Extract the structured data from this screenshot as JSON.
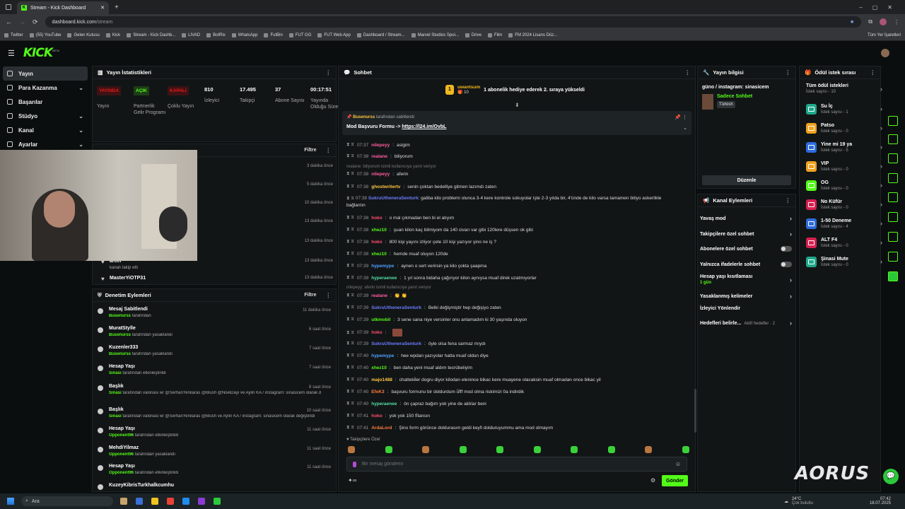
{
  "browser": {
    "tab_title": "Stream - Kick Dashboard",
    "url_host": "dashboard.kick.com",
    "url_path": "/stream",
    "bookmarks": [
      "Twitter",
      "(55) YouTube",
      "Gelen Kutusu",
      "Kick",
      "Stream - Kick Dashb...",
      "LIVAD",
      "BotRix",
      "WhatsApp",
      "FutBin",
      "FUT GG",
      "FUT Web App",
      "Dashboard / Stream...",
      "Marvel Studios Spoi...",
      "Drive",
      "Film",
      "FM 2024 Lisans Düz..."
    ],
    "all_bookmarks": "Tüm Yer İşaretleri"
  },
  "app": {
    "logo": "KICK",
    "logo_sup": "BETA"
  },
  "sidebar": {
    "items": [
      {
        "label": "Yayın"
      },
      {
        "label": "Para Kazanma"
      },
      {
        "label": "Başarılar"
      },
      {
        "label": "Stüdyo"
      },
      {
        "label": "Kanal"
      },
      {
        "label": "Ayarlar"
      }
    ]
  },
  "stats": {
    "title": "Yayın İstatistikleri",
    "cols": [
      {
        "badge": "YAYINDA",
        "badge_color": "#e91916",
        "label": "Yayın"
      },
      {
        "badge": "AÇIK",
        "badge_color": "#53fc18",
        "label": "Partnerlik Gelir Programı"
      },
      {
        "badge": "KAPALI",
        "badge_color": "#e91916",
        "label": "Çoklu Yayın"
      },
      {
        "value": "810",
        "label": "İzleyici"
      },
      {
        "value": "17.495",
        "label": "Takipçi"
      },
      {
        "value": "37",
        "label": "Abone Sayısı"
      },
      {
        "value": "00:17:51",
        "label": "Yayında Olduğu Süre"
      }
    ]
  },
  "activity": {
    "filter": "Filtre",
    "rows": [
      {
        "time": "3 dakika önce"
      },
      {
        "time": "5 dakika önce"
      },
      {
        "time": "10 dakika önce"
      },
      {
        "time": "13 dakika önce"
      },
      {
        "time": "13 dakika önce"
      },
      {
        "name": "arcer",
        "sub": "kanalı takip etti",
        "time": "13 dakika önce"
      },
      {
        "name": "MasterYiOTP31",
        "time": "13 dakika önce"
      }
    ]
  },
  "mod": {
    "title": "Denetim Eylemleri",
    "filter": "Filtre",
    "events": [
      {
        "title": "Mesaj Sabitlendi",
        "user": "Busenurss",
        "action": "tarafından",
        "time": "11 dakika önce"
      },
      {
        "title": "MuratStylle",
        "user": "Busenurss",
        "action": "tarafından yasaklandı",
        "time": "6 saat önce"
      },
      {
        "title": "Kuzenler333",
        "user": "Busenurss",
        "action": "tarafından yasaklandı",
        "time": "7 saat önce"
      },
      {
        "title": "Hesap Yaşı",
        "user": "Sinasi",
        "action": "tarafından etkinleştirildi",
        "time": "7 saat önce"
      },
      {
        "title": "Başlık",
        "user": "Sinasi",
        "action": "tarafından valonasi w/ @SerhanYenilaras @Blush @NoelDayi ve Aylin KA / instagram: sinasicem olarak değiştirildi",
        "time": "8 saat önce"
      },
      {
        "title": "Başlık",
        "user": "Sinasi",
        "action": "tarafından valonasi w/ @SerhanYenilaras @Blush ve Aylin KA / instagram: sinasicem olarak değiştirildi",
        "time": "10 saat önce"
      },
      {
        "title": "Hesap Yaşı",
        "user": "Opponent96",
        "action": "tarafından etkinleştirildi",
        "time": "11 saat önce"
      },
      {
        "title": "MehdiYilmaz",
        "user": "Opponent96",
        "action": "tarafından yasaklandı",
        "time": "11 saat önce"
      },
      {
        "title": "Hesap Yaşı",
        "user": "Opponent96",
        "action": "tarafından etkinleştirildi",
        "time": "11 saat önce"
      },
      {
        "title": "KuzeyKibrisTurkhalkcumhu",
        "user": "",
        "action": "",
        "time": ""
      }
    ]
  },
  "chat": {
    "title": "Sohbet",
    "gift": {
      "user": "uwantsum",
      "count": "10",
      "rank": "1",
      "text": "1 abonelik hediye ederek 2. sıraya yükseldi"
    },
    "pinned": {
      "by": "Busenurss",
      "by_suffix": "tarafından sabitlendi",
      "text": "Mod Başvuru Formu ->",
      "link": "https://l24.im/OvbL"
    },
    "messages": [
      {
        "time": "07:37",
        "user": "nilepeyy",
        "color": "#ff5da2",
        "text": "asigim"
      },
      {
        "time": "07:38",
        "user": "realane",
        "color": "#ff5da2",
        "text": "biliyorum"
      },
      {
        "reply": "realane: biliyorum isimli kullanıcıya yanıt veriyor"
      },
      {
        "time": "07:38",
        "user": "nilepeyy",
        "color": "#ff5da2",
        "text": "aferin"
      },
      {
        "time": "07:38",
        "user": "ghostwritertv",
        "color": "#ffc640",
        "text": "senin çoktan bedelliye gitmen lazımdı zaten"
      },
      {
        "time": "07:38",
        "user": "SukruUtheneraSenturk",
        "color": "#6b7cff",
        "text": "galiba kilo problemi olunca 3-4 kere kontrole sokuyolar işte 2-3 yılda bir, 4'ünde de kilo varsa tamamen bitiyo askerlikle bağlantın"
      },
      {
        "time": "07:38",
        "user": "hoko",
        "color": "#ff4d6d",
        "text": "o mal çıkmadan ben bi el atıyım"
      },
      {
        "time": "07:38",
        "user": "xhez10",
        "color": "#53fc18",
        "text": "şuan kilon kaç bilmiyom da 140 civarı var gibi 120lere düşsen ok gibi"
      },
      {
        "time": "07:38",
        "user": "hoko",
        "color": "#ff4d6d",
        "text": "800 kişi yayını izliyor çete 10 kişi yazıyor şino ne iş ?"
      },
      {
        "time": "07:38",
        "user": "xhez10",
        "color": "#53fc18",
        "text": "hemde muaf oluyon 120de"
      },
      {
        "time": "07:39",
        "user": "hypemype",
        "color": "#4ea1ff",
        "text": "aynen o sert verirsin ya kilo çokta şaapma"
      },
      {
        "time": "07:39",
        "user": "hyperaenee",
        "color": "#53e0a0",
        "text": "1 yıl sonra bidaha çağırıyor kilon aynıysa muaf direk uzatmıyorlar"
      },
      {
        "reply": "nilepeyy: aferin isimli kullanıcıya yanıt veriyor"
      },
      {
        "time": "07:39",
        "user": "realane",
        "color": "#ff5da2",
        "text": "👏 👏"
      },
      {
        "time": "07:39",
        "user": "SukruUtheneraSenturk",
        "color": "#6b7cff",
        "text": "Belki değişmiştir hep değişiyo zaten"
      },
      {
        "time": "07:39",
        "user": "utkmobil",
        "color": "#53fc18",
        "text": "3 sene sana niye versinler onu anlamadım ki 30 yaşında oluyon"
      },
      {
        "time": "07:39",
        "user": "hoko",
        "color": "#ff4d6d",
        "text": ""
      },
      {
        "time": "07:39",
        "user": "SukruUtheneraSenturk",
        "color": "#6b7cff",
        "text": "öyle olsa fena sarmaz mıydı"
      },
      {
        "time": "07:40",
        "user": "hypemype",
        "color": "#4ea1ff",
        "text": "hee wpdan yazıyolar hatta muaf oldun diye"
      },
      {
        "time": "07:40",
        "user": "xhez10",
        "color": "#53fc18",
        "text": "ben daha yeni muaf aldım tecrübeliyim"
      },
      {
        "time": "07:40",
        "user": "majo1488",
        "color": "#ffc640",
        "text": "chatteki̇ler dogru diyor kilodan elenince bikac kere muayene olacaksin muaf olmadan once bikac yil"
      },
      {
        "time": "07:40",
        "user": "EfeK3",
        "color": "#ff7a3d",
        "text": "başvuru formunu bir doldurdum ü̈fff mod olma riskimizi 0a indirdik"
      },
      {
        "time": "07:40",
        "user": "hyperaenee",
        "color": "#53e0a0",
        "text": "ön çapraz bağım yok yine de aldılar beni"
      },
      {
        "time": "07:41",
        "user": "hoko",
        "color": "#ff4d6d",
        "text": "yok yok 150 fİlansın"
      },
      {
        "time": "07:41",
        "user": "ArdaLord",
        "color": "#ff7a3d",
        "text": "Şino form görünce doldurasım geldi keyfi dolduruyummu ama mod olmayım"
      }
    ],
    "emote_label": "Takipçilere Özel",
    "input_placeholder": "Bir mesaj gönderin",
    "send": "Gönder"
  },
  "info": {
    "title": "Yayın bilgisi",
    "stream_title": "güno / instagram: sinasicem",
    "mode": "Sadece Sohbet",
    "lang": "Türkish",
    "edit": "Düzenle"
  },
  "actions": {
    "title": "Kanal Eylemleri",
    "items": [
      {
        "label": "Yavaş mod",
        "type": "chev"
      },
      {
        "label": "Takipçilere özel sohbet",
        "type": "chev"
      },
      {
        "label": "Abonelere özel sohbet",
        "type": "toggle"
      },
      {
        "label": "Yalnızca ifadelerle sohbet",
        "type": "toggle"
      },
      {
        "label": "Hesap yaşı kısıtlaması",
        "sub": "1 gün",
        "type": "chev"
      },
      {
        "label": "Yasaklanmış kelimeler",
        "type": "chev"
      },
      {
        "label": "İzleyici Yönlendir",
        "type": "none"
      },
      {
        "label": "Hedefleri belirle...",
        "sub": "Aktif hedefler · 2",
        "type": "chev"
      }
    ]
  },
  "rewards": {
    "title": "Ödül istek sırası",
    "all": "Tüm ödül istekleri",
    "all_count": "İstek sayısı - 10",
    "items": [
      {
        "name": "Su İç",
        "count": "İstek sayısı - 1",
        "color": "#1fa88a"
      },
      {
        "name": "Patso",
        "count": "İstek sayısı - 0",
        "color": "#f0a21e"
      },
      {
        "name": "Yine mi 19 ya",
        "count": "İstek sayısı - 5",
        "color": "#2d6bdc"
      },
      {
        "name": "VIP",
        "count": "İstek sayısı - 0",
        "color": "#f0a21e"
      },
      {
        "name": "OG",
        "count": "İstek sayısı - 0",
        "color": "#53fc18"
      },
      {
        "name": "No Küfür",
        "count": "İstek sayısı - 0",
        "color": "#d62050"
      },
      {
        "name": "1-50 Deneme",
        "count": "İstek sayısı - 4",
        "color": "#2d6bdc"
      },
      {
        "name": "ALT F4",
        "count": "İstek sayısı - 0",
        "color": "#d62050"
      },
      {
        "name": "Şinasi Mute",
        "count": "İstek sayısı - 0",
        "color": "#1fa88a"
      }
    ]
  },
  "taskbar": {
    "search": "Ara",
    "weather": "24°C",
    "weather_desc": "Çok bulutlu",
    "time": "07:42",
    "date": "18.07.2025"
  },
  "overlay": {
    "brand": "AORUS"
  }
}
